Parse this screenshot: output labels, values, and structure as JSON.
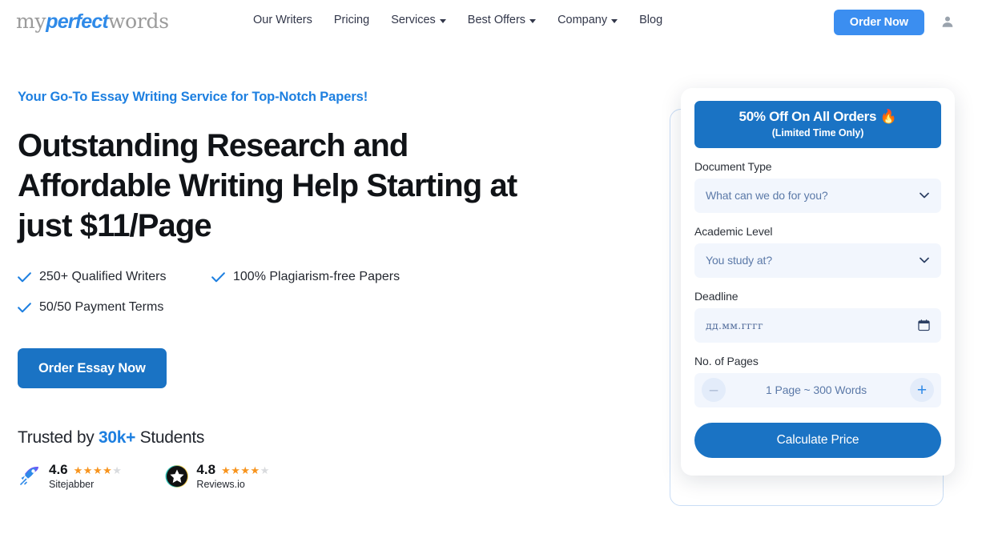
{
  "header": {
    "logo": {
      "part1": "my",
      "part2": "perfect",
      "part3": "words"
    },
    "nav": [
      {
        "label": "Our Writers",
        "has_caret": false
      },
      {
        "label": "Pricing",
        "has_caret": false
      },
      {
        "label": "Services",
        "has_caret": true
      },
      {
        "label": "Best Offers",
        "has_caret": true
      },
      {
        "label": "Company",
        "has_caret": true
      },
      {
        "label": "Blog",
        "has_caret": false
      }
    ],
    "order_now_label": "Order Now",
    "account_icon": "user-icon"
  },
  "hero": {
    "eyebrow": "Your Go-To Essay Writing Service for Top-Notch Papers!",
    "headline": "Outstanding Research and Affordable Writing Help Starting at just $11/Page",
    "features": [
      "250+ Qualified Writers",
      "100% Plagiarism-free Papers",
      "50/50 Payment Terms"
    ],
    "cta_label": "Order Essay Now",
    "trusted": {
      "prefix": "Trusted by ",
      "count": "30k+",
      "suffix": " Students"
    },
    "ratings": [
      {
        "score": "4.6",
        "name": "Sitejabber",
        "filled_stars": 4,
        "total_stars": 5,
        "icon": "rocket-icon"
      },
      {
        "score": "4.8",
        "name": "Reviews.io",
        "filled_stars": 4,
        "total_stars": 5,
        "icon": "star-badge-icon"
      }
    ]
  },
  "order_form": {
    "promo_main": "50% Off On All Orders 🔥",
    "promo_sub": "(Limited Time Only)",
    "document_type": {
      "label": "Document Type",
      "placeholder": "What can we do for you?"
    },
    "academic_level": {
      "label": "Academic Level",
      "placeholder": "You study at?"
    },
    "deadline": {
      "label": "Deadline",
      "placeholder": "дд.мм.гггг"
    },
    "pages": {
      "label": "No. of Pages",
      "value": "1 Page ~ 300 Words",
      "decrement_label": "–",
      "increment_label": "+"
    },
    "submit_label": "Calculate Price"
  },
  "colors": {
    "accent_blue": "#1a73c4",
    "light_blue": "#3b8ef0",
    "link_blue": "#1d7fe0",
    "star_orange": "#f7941e",
    "field_bg": "#f2f6fd",
    "placeholder": "#5b79a8"
  }
}
